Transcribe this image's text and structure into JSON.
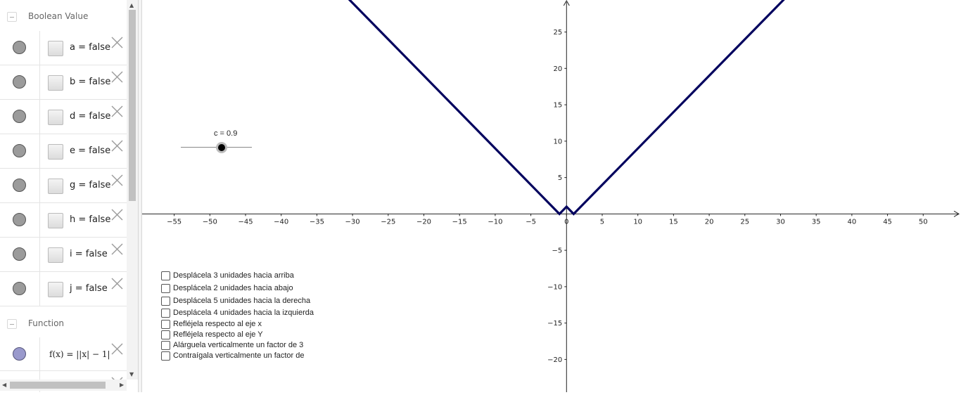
{
  "algebra_view": {
    "sections": [
      {
        "label": "Boolean Value"
      },
      {
        "label": "Function"
      }
    ],
    "boolean_items": [
      {
        "text": "a = false"
      },
      {
        "text": "b = false"
      },
      {
        "text": "d = false"
      },
      {
        "text": "e = false"
      },
      {
        "text": "g = false"
      },
      {
        "text": "h = false"
      },
      {
        "text": "i = false"
      },
      {
        "text": "j = false"
      }
    ],
    "function_items": [
      {
        "text": "f(x) = ||x| − 1|"
      }
    ],
    "icons": {
      "marble": "visibility-marble-icon",
      "delete": "close-icon",
      "collapse": "collapse-minus-icon"
    }
  },
  "slider": {
    "label": "c = 0.9",
    "value": 0.9
  },
  "checkbox_panel": {
    "items": [
      {
        "label": "Desplácela 3 unidades hacia arriba",
        "checked": false
      },
      {
        "label": "Desplácela 2 unidades hacia abajo",
        "checked": false
      },
      {
        "label": "Desplácela 5 unidades hacia la derecha",
        "checked": false
      },
      {
        "label": "Desplácela 4 unidades hacia la izquierda",
        "checked": false
      },
      {
        "label": "Refléjela respecto al eje x",
        "checked": false
      },
      {
        "label": "Refléjela respecto al eje Y",
        "checked": false
      },
      {
        "label": "Alárguela verticalmente un factor de 3",
        "checked": false
      },
      {
        "label": "Contraígala verticalmente un factor de",
        "checked": false
      }
    ]
  },
  "colors": {
    "curve": "#00005e",
    "axis": "#222222",
    "marble_boolean": "#9b9b9b",
    "marble_function": "#9999cc"
  },
  "chart_data": {
    "type": "line",
    "title": "",
    "xlabel": "",
    "ylabel": "",
    "xlim": [
      -59.5,
      55.3
    ],
    "ylim": [
      -24.5,
      29.4
    ],
    "x_ticks": [
      -55,
      -50,
      -45,
      -40,
      -35,
      -30,
      -25,
      -20,
      -15,
      -10,
      -5,
      0,
      5,
      10,
      15,
      20,
      25,
      30,
      35,
      40,
      45,
      50
    ],
    "y_ticks": [
      -20,
      -15,
      -10,
      -5,
      5,
      10,
      15,
      20,
      25
    ],
    "grid": false,
    "series": [
      {
        "function": "f(x) = ||x| − 1|",
        "x": [
          -32,
          -1,
          0,
          1,
          32
        ],
        "y": [
          31,
          0,
          1,
          0,
          31
        ]
      }
    ]
  }
}
